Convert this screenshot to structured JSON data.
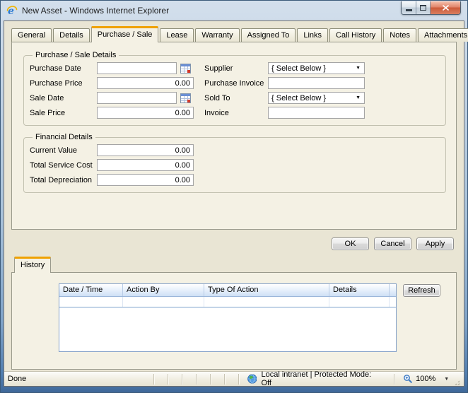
{
  "window": {
    "title": "New Asset - Windows Internet Explorer"
  },
  "tabs": [
    {
      "label": "General"
    },
    {
      "label": "Details"
    },
    {
      "label": "Purchase / Sale"
    },
    {
      "label": "Lease"
    },
    {
      "label": "Warranty"
    },
    {
      "label": "Assigned To"
    },
    {
      "label": "Links"
    },
    {
      "label": "Call History"
    },
    {
      "label": "Notes"
    },
    {
      "label": "Attachments"
    }
  ],
  "form": {
    "purchase_section": {
      "legend": "Purchase / Sale Details",
      "fields": {
        "purchase_date": {
          "label": "Purchase Date",
          "value": ""
        },
        "purchase_price": {
          "label": "Purchase Price",
          "value": "0.00"
        },
        "sale_date": {
          "label": "Sale Date",
          "value": ""
        },
        "sale_price": {
          "label": "Sale Price",
          "value": "0.00"
        },
        "supplier": {
          "label": "Supplier",
          "value": "{ Select Below }"
        },
        "purchase_invoice": {
          "label": "Purchase Invoice",
          "value": ""
        },
        "sold_to": {
          "label": "Sold To",
          "value": "{ Select Below }"
        },
        "invoice": {
          "label": "Invoice",
          "value": ""
        }
      }
    },
    "financial_section": {
      "legend": "Financial Details",
      "fields": {
        "current_value": {
          "label": "Current Value",
          "value": "0.00"
        },
        "total_service_cost": {
          "label": "Total Service Cost",
          "value": "0.00"
        },
        "total_depreciation": {
          "label": "Total Depreciation",
          "value": "0.00"
        }
      }
    }
  },
  "buttons": {
    "ok": "OK",
    "cancel": "Cancel",
    "apply": "Apply"
  },
  "history": {
    "tab_label": "History",
    "columns": [
      "Date / Time",
      "Action By",
      "Type Of Action",
      "Details"
    ],
    "refresh_label": "Refresh"
  },
  "statusbar": {
    "status": "Done",
    "zone": "Local intranet | Protected Mode: Off",
    "zoom": "100%"
  },
  "icons": {
    "combo_arrow": "▼",
    "zoom_dropdown_arrow": "▼"
  },
  "colors": {
    "active_tab_accent": "#efa100",
    "frame_blue": "#7fa3c8",
    "client_beige": "#e9e5d4",
    "panel_beige": "#f4f1e4",
    "grid_border_blue": "#83a0c8",
    "close_button_red": "#cc5a3a"
  }
}
